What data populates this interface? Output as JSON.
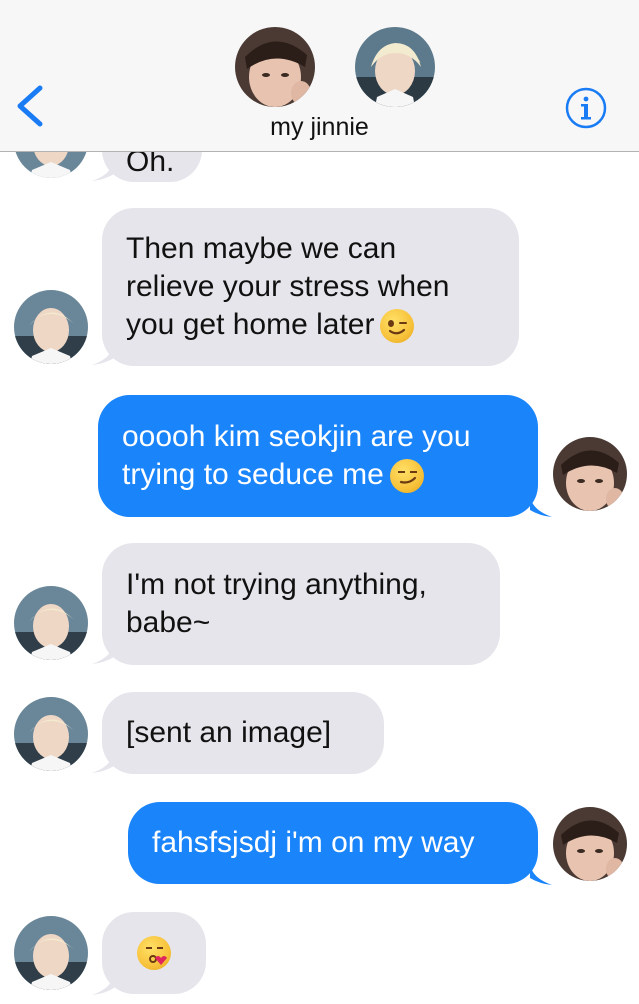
{
  "header": {
    "contact_name": "my jinnie",
    "back_icon": "chevron-left-icon",
    "info_icon": "info-circle-icon",
    "accent_color": "#1a7cf5"
  },
  "messages": [
    {
      "side": "incoming",
      "text": "Oh."
    },
    {
      "side": "incoming",
      "text": "Then maybe we can\nrelieve your stress when\nyou get home later",
      "emoji": "winking-face"
    },
    {
      "side": "outgoing",
      "text": "ooooh kim seokjin are you\ntrying to seduce me",
      "emoji": "smirking-face"
    },
    {
      "side": "incoming",
      "text": "I'm not trying anything,\nbabe~"
    },
    {
      "side": "incoming",
      "text": "[sent an image]"
    },
    {
      "side": "outgoing",
      "text": "fahsfsjsdj i'm on my way"
    },
    {
      "side": "incoming",
      "text": "",
      "emoji": "face-blowing-kiss"
    }
  ],
  "colors": {
    "incoming_bubble": "#e6e5eb",
    "outgoing_bubble": "#1a84fb",
    "header_bg": "#f7f7f7"
  }
}
